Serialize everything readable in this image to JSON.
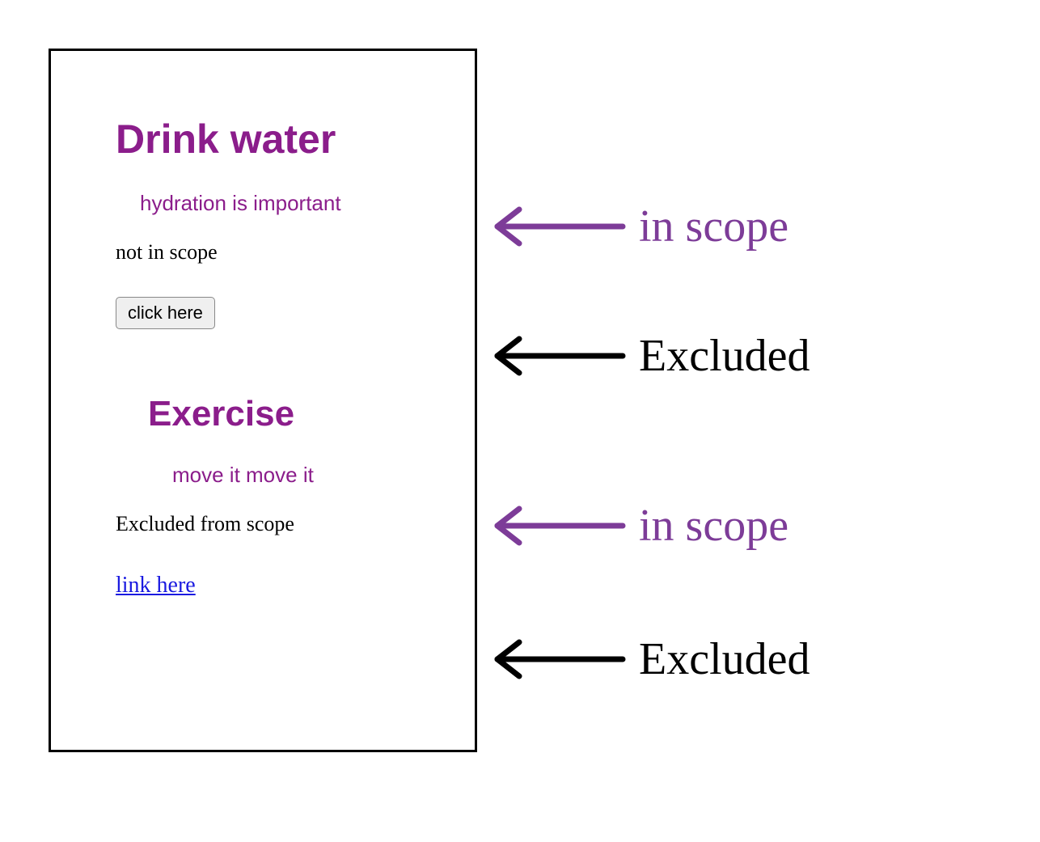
{
  "box": {
    "section1": {
      "heading": "Drink water",
      "subtext": "hydration is important",
      "plain": "not in scope",
      "button_label": "click here"
    },
    "section2": {
      "heading": "Exercise",
      "subtext": "move it move it",
      "plain": "Excluded from scope",
      "link_label": "link here"
    }
  },
  "annotations": {
    "a1": "in scope",
    "a2": "Excluded",
    "a3": "in scope",
    "a4": "Excluded"
  },
  "colors": {
    "purple": "#8b1d8b",
    "annotation_purple": "#7d3c98",
    "black": "#000000",
    "link_blue": "#1a1ae0"
  }
}
